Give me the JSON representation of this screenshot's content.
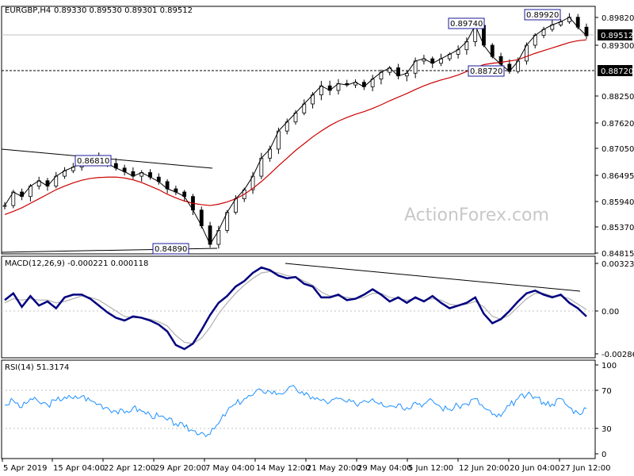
{
  "chart_data": [
    {
      "type": "candlestick",
      "title": "EURGBP,H4",
      "ohlc_header": "0.89330 0.89530 0.89301 0.89512",
      "watermark": "ActionForex.com",
      "yticks": [
        "0.89820",
        "0.89300",
        "0.88250",
        "0.87620",
        "0.87050",
        "0.86495",
        "0.85940",
        "0.85370",
        "0.84815"
      ],
      "ylim": [
        0.8475,
        0.8995
      ],
      "last_price": "0.89512",
      "hline_label": "0.88720",
      "hline_value": 0.8872,
      "annotations": [
        {
          "label": "0.86810",
          "value": 0.8681
        },
        {
          "label": "0.84890",
          "value": 0.8489
        },
        {
          "label": "0.89740",
          "value": 0.8974
        },
        {
          "label": "0.88720",
          "value": 0.8872
        },
        {
          "label": "0.89920",
          "value": 0.8992
        }
      ],
      "series": [
        {
          "name": "price",
          "values": [
            0.8575,
            0.8605,
            0.8595,
            0.8618,
            0.863,
            0.8618,
            0.864,
            0.8652,
            0.866,
            0.8668,
            0.8678,
            0.8681,
            0.8668,
            0.8658,
            0.865,
            0.864,
            0.8648,
            0.8638,
            0.8628,
            0.8612,
            0.8605,
            0.8595,
            0.8565,
            0.853,
            0.8489,
            0.852,
            0.856,
            0.859,
            0.861,
            0.864,
            0.868,
            0.87,
            0.874,
            0.876,
            0.878,
            0.88,
            0.882,
            0.884,
            0.883,
            0.8845,
            0.8842,
            0.8848,
            0.8838,
            0.8855,
            0.887,
            0.888,
            0.8862,
            0.8868,
            0.8895,
            0.89,
            0.889,
            0.89,
            0.891,
            0.892,
            0.8938,
            0.8974,
            0.893,
            0.8905,
            0.8888,
            0.8872,
            0.8895,
            0.893,
            0.8952,
            0.8965,
            0.8975,
            0.8982,
            0.8992,
            0.897,
            0.8951
          ]
        },
        {
          "name": "moving average",
          "values": [
            0.8555,
            0.8562,
            0.857,
            0.858,
            0.859,
            0.86,
            0.861,
            0.8618,
            0.8625,
            0.8631,
            0.8635,
            0.8637,
            0.8638,
            0.8638,
            0.8636,
            0.8632,
            0.8626,
            0.8618,
            0.861,
            0.86,
            0.8592,
            0.8585,
            0.858,
            0.8577,
            0.8575,
            0.8578,
            0.8583,
            0.859,
            0.86,
            0.8613,
            0.8628,
            0.8645,
            0.8663,
            0.868,
            0.8697,
            0.8712,
            0.8727,
            0.874,
            0.8752,
            0.8762,
            0.877,
            0.8777,
            0.8783,
            0.879,
            0.8798,
            0.8807,
            0.8815,
            0.8823,
            0.8832,
            0.884,
            0.8847,
            0.8853,
            0.8858,
            0.8864,
            0.8872,
            0.888,
            0.8887,
            0.889,
            0.8892,
            0.8895,
            0.8898,
            0.8905,
            0.8912,
            0.8918,
            0.8924,
            0.893,
            0.8936,
            0.894,
            0.8942
          ]
        }
      ]
    },
    {
      "type": "line",
      "title": "MACD(12,26,9) -0.000221 0.000118",
      "yticks": [
        "0.003239",
        "0.00",
        "-0.002868"
      ],
      "ylim": [
        -0.00315,
        0.0035
      ],
      "series": [
        {
          "name": "macd",
          "values": [
            0.0008,
            0.0013,
            0.0003,
            0.0011,
            0.0004,
            0.0007,
            0.0002,
            0.001,
            0.0012,
            0.0012,
            0.0009,
            0.0004,
            -0.0001,
            -0.0005,
            -0.0007,
            -0.0004,
            -0.0005,
            -0.0007,
            -0.001,
            -0.0015,
            -0.0025,
            -0.0028,
            -0.0024,
            -0.0014,
            -0.0003,
            0.0006,
            0.0011,
            0.0018,
            0.0022,
            0.0028,
            0.0032,
            0.003,
            0.0026,
            0.0024,
            0.0025,
            0.002,
            0.0018,
            0.001,
            0.001,
            0.0012,
            0.0008,
            0.0009,
            0.0012,
            0.0016,
            0.0012,
            0.0007,
            0.001,
            0.0006,
            0.001,
            0.0007,
            0.0011,
            0.0006,
            0.0002,
            0.0004,
            0.0006,
            0.001,
            -0.0002,
            -0.0009,
            -0.0006,
            0.0,
            0.0007,
            0.0013,
            0.0015,
            0.0012,
            0.001,
            0.0012,
            0.0006,
            0.0002,
            -0.0004
          ]
        },
        {
          "name": "signal",
          "values": [
            0.0006,
            0.0009,
            0.0008,
            0.0009,
            0.0008,
            0.0008,
            0.0006,
            0.0007,
            0.0009,
            0.0011,
            0.001,
            0.0008,
            0.0004,
            0.0,
            -0.0004,
            -0.0005,
            -0.0005,
            -0.0006,
            -0.0008,
            -0.0011,
            -0.0018,
            -0.0023,
            -0.0024,
            -0.002,
            -0.0012,
            -0.0002,
            0.0006,
            0.0013,
            0.0019,
            0.0024,
            0.0028,
            0.0029,
            0.0028,
            0.0026,
            0.0025,
            0.0022,
            0.0019,
            0.0014,
            0.0011,
            0.0011,
            0.001,
            0.0009,
            0.001,
            0.0013,
            0.0013,
            0.001,
            0.0009,
            0.0008,
            0.0009,
            0.0008,
            0.0009,
            0.0008,
            0.0005,
            0.0004,
            0.0005,
            0.0007,
            0.0003,
            -0.0004,
            -0.0006,
            -0.0003,
            0.0003,
            0.0009,
            0.0013,
            0.0013,
            0.0011,
            0.0011,
            0.0009,
            0.0005,
            0.0001
          ]
        }
      ]
    },
    {
      "type": "line",
      "title": "RSI(14) 51.3174",
      "yticks": [
        "100",
        "70",
        "30",
        "0"
      ],
      "ylim": [
        0,
        100
      ],
      "levels": [
        70,
        30
      ],
      "series": [
        {
          "name": "rsi",
          "values": [
            55,
            60,
            52,
            62,
            58,
            55,
            60,
            64,
            62,
            65,
            60,
            56,
            52,
            48,
            46,
            52,
            48,
            44,
            42,
            38,
            34,
            30,
            26,
            24,
            22,
            34,
            48,
            56,
            62,
            66,
            72,
            70,
            68,
            72,
            74,
            66,
            64,
            60,
            58,
            62,
            58,
            56,
            60,
            62,
            58,
            54,
            56,
            52,
            58,
            56,
            60,
            52,
            50,
            54,
            56,
            62,
            52,
            44,
            42,
            54,
            62,
            66,
            64,
            58,
            56,
            62,
            52,
            46,
            51
          ]
        }
      ]
    }
  ],
  "xaxis": {
    "labels": [
      "5 Apr 2019",
      "15 Apr 04:00",
      "22 Apr 12:00",
      "29 Apr 20:00",
      "7 May 04:00",
      "14 May 12:00",
      "21 May 20:00",
      "29 May 04:00",
      "5 Jun 12:00",
      "12 Jun 20:00",
      "20 Jun 04:00",
      "27 Jun 12:00"
    ]
  },
  "colors": {
    "price": "#000000",
    "ma": "#cc0000",
    "macd": "#000080",
    "signal": "#b0b0b0",
    "rsi": "#1e90ff",
    "grid": "#c0c0c0",
    "label_border": "#1a1a99"
  }
}
